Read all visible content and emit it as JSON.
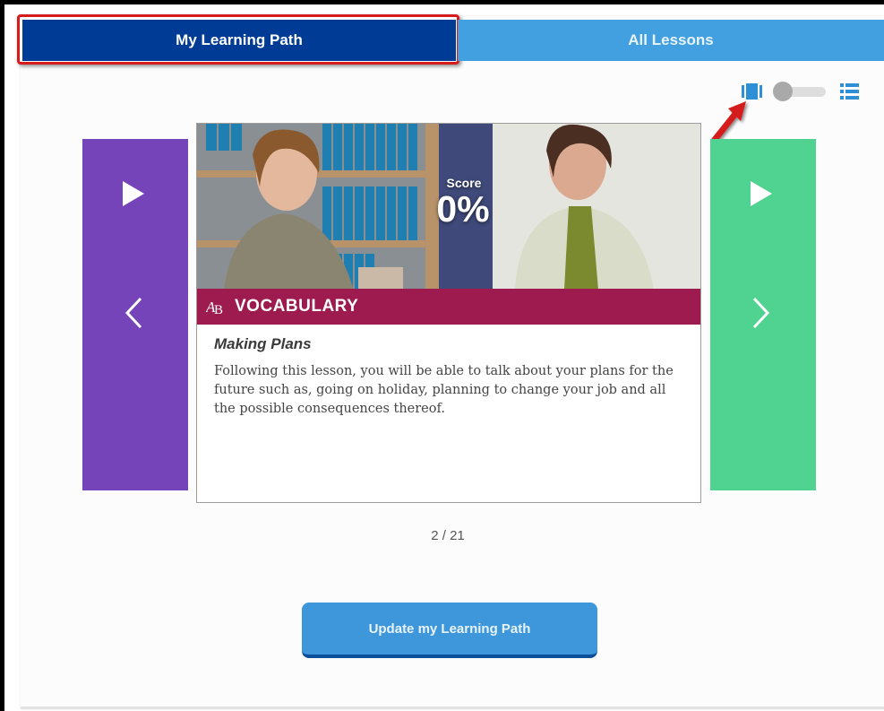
{
  "tabs": [
    {
      "label": "My Learning Path",
      "active": true
    },
    {
      "label": "All Lessons",
      "active": false
    }
  ],
  "view_toggle": {
    "left_icon": "card-view-icon",
    "right_icon": "list-view-icon",
    "state": "card"
  },
  "lesson": {
    "score_label": "Score",
    "score_value": "0%",
    "category": "VOCABULARY",
    "category_icon": "ab-logo-icon",
    "title": "Making Plans",
    "description": "Following this lesson, you will be able to talk about your plans for the future such as, going on holiday, planning to change your job and all the possible consequences thereof."
  },
  "pager": {
    "current": 2,
    "total": 21,
    "text": "2 / 21"
  },
  "update_button": {
    "label": "Update my Learning Path"
  },
  "colors": {
    "active_tab": "#003c96",
    "inactive_tab": "#42a0e0",
    "prev_card": "#7444b8",
    "next_card": "#50d390",
    "category_bar": "#9d1b4e",
    "button": "#3d97da",
    "highlight": "#d51b1b"
  }
}
